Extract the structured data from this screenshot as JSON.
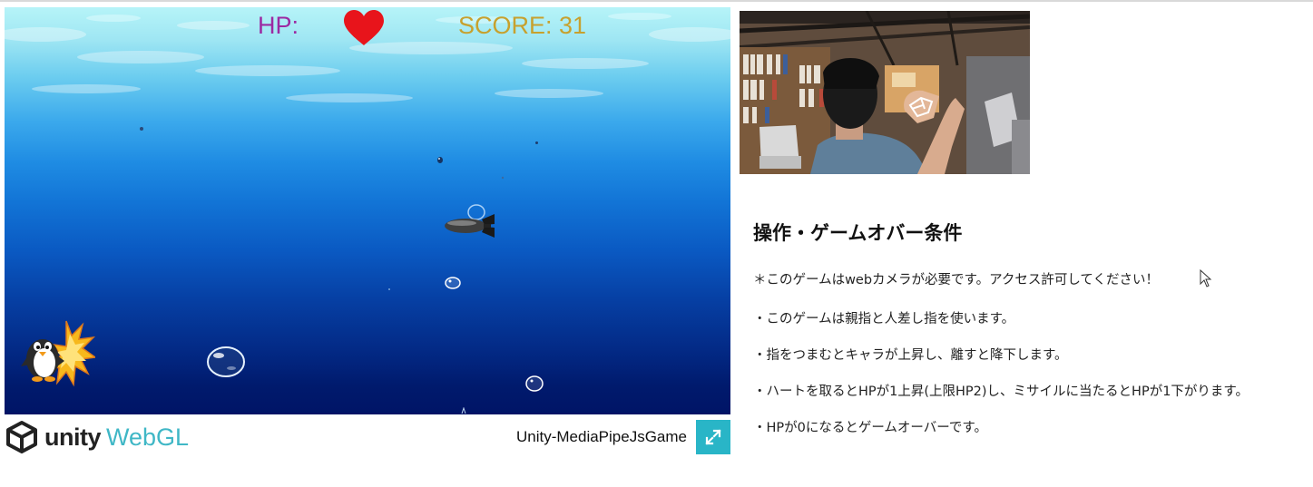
{
  "game": {
    "hud": {
      "hp_label": "HP:",
      "hp_hearts": 1,
      "score_label": "SCORE: 31"
    }
  },
  "unity_footer": {
    "unity_text": "unity",
    "webgl_text": "WebGL",
    "build_title": "Unity-MediaPipeJsGame",
    "fullscreen_icon": "fullscreen-icon"
  },
  "instructions": {
    "heading": "操作・ゲームオバー条件",
    "note": "＊このゲームはwebカメラが必要です。アクセス許可してください！",
    "rules": [
      "・このゲームは親指と人差し指を使います。",
      "・指をつまむとキャラが上昇し、離すと降下します。",
      "・ハートを取るとHPが1上昇(上限HP2)し、ミサイルに当たるとHPが1下がります。",
      "・HPが0になるとゲームオーバーです。"
    ]
  },
  "colors": {
    "hp_label": "#9c2aa2",
    "score_label": "#c7a12e",
    "heart": "#e8141b",
    "webgl_accent": "#3fb7c6",
    "fullscreen_button": "#29b5c7"
  }
}
